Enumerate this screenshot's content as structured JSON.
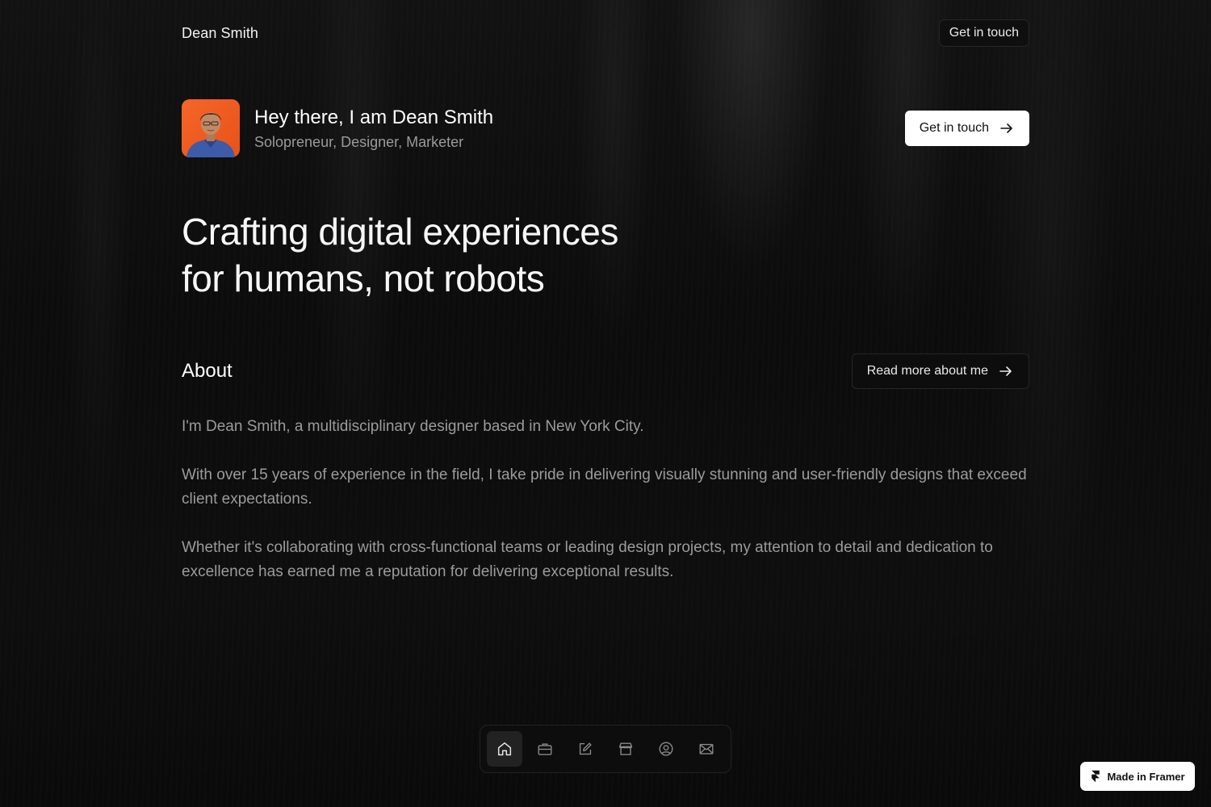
{
  "header": {
    "brand": "Dean Smith",
    "cta_label": "Get in touch"
  },
  "profile": {
    "greeting": "Hey there, I am Dean Smith",
    "roles": "Solopreneur, Designer, Marketer",
    "cta_label": "Get in touch",
    "cta_icon": "arrow-right-icon",
    "avatar_bg_color": "#f05a1e"
  },
  "hero": {
    "line1": "Crafting digital experiences",
    "line2": "for humans, not robots"
  },
  "about": {
    "title": "About",
    "cta_label": "Read more about me",
    "cta_icon": "arrow-right-icon",
    "paragraphs": [
      "I'm Dean Smith, a multidisciplinary designer based in New York City.",
      "With over 15 years of experience in the field, I take pride in delivering visually stunning and user-friendly designs that exceed client expectations.",
      "Whether it's collaborating with cross-functional teams or leading design projects, my attention to detail and dedication to excellence has earned me a reputation for delivering exceptional results."
    ]
  },
  "dock": {
    "items": [
      {
        "icon": "home-icon",
        "active": true
      },
      {
        "icon": "briefcase-icon",
        "active": false
      },
      {
        "icon": "edit-icon",
        "active": false
      },
      {
        "icon": "store-icon",
        "active": false
      },
      {
        "icon": "user-circle-icon",
        "active": false
      },
      {
        "icon": "mail-icon",
        "active": false
      }
    ]
  },
  "badge": {
    "label": "Made in Framer",
    "icon": "framer-logo-icon"
  },
  "colors": {
    "background": "#0b0b0b",
    "text_primary": "#ffffff",
    "text_muted": "#9b9b9b",
    "button_light": "#ffffff",
    "accent_orange": "#f05a1e"
  }
}
